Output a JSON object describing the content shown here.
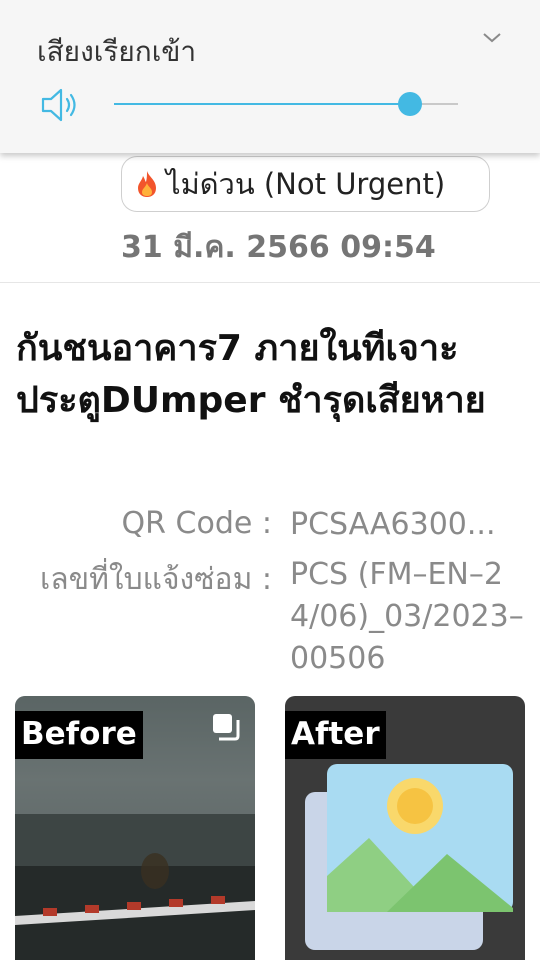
{
  "volume_panel": {
    "title": "เสียงเรียกเข้า",
    "level_fraction": 0.86,
    "accent_color": "#43b9e3",
    "icons": {
      "speaker": "speaker-icon",
      "collapse": "chevron-down-icon"
    }
  },
  "ticket": {
    "urgency_label": "ไม่ด่วน (Not Urgent)",
    "urgency_icon": "fire-icon",
    "datetime": "31 มี.ค. 2566 09:54",
    "title": "กันชนอาคาร7 ภายในทีเจาะประตูDUmper ชำรุดเสียหาย",
    "fields": {
      "qr_code": {
        "label": "QR Code :",
        "value": "PCSAA6300..."
      },
      "repair_no": {
        "label": "เลขที่ใบแจ้งซ่อม :",
        "value": "PCS (FM–EN–24/06)_03/2023–00506"
      }
    }
  },
  "photos": {
    "before_label": "Before",
    "after_label": "After"
  }
}
